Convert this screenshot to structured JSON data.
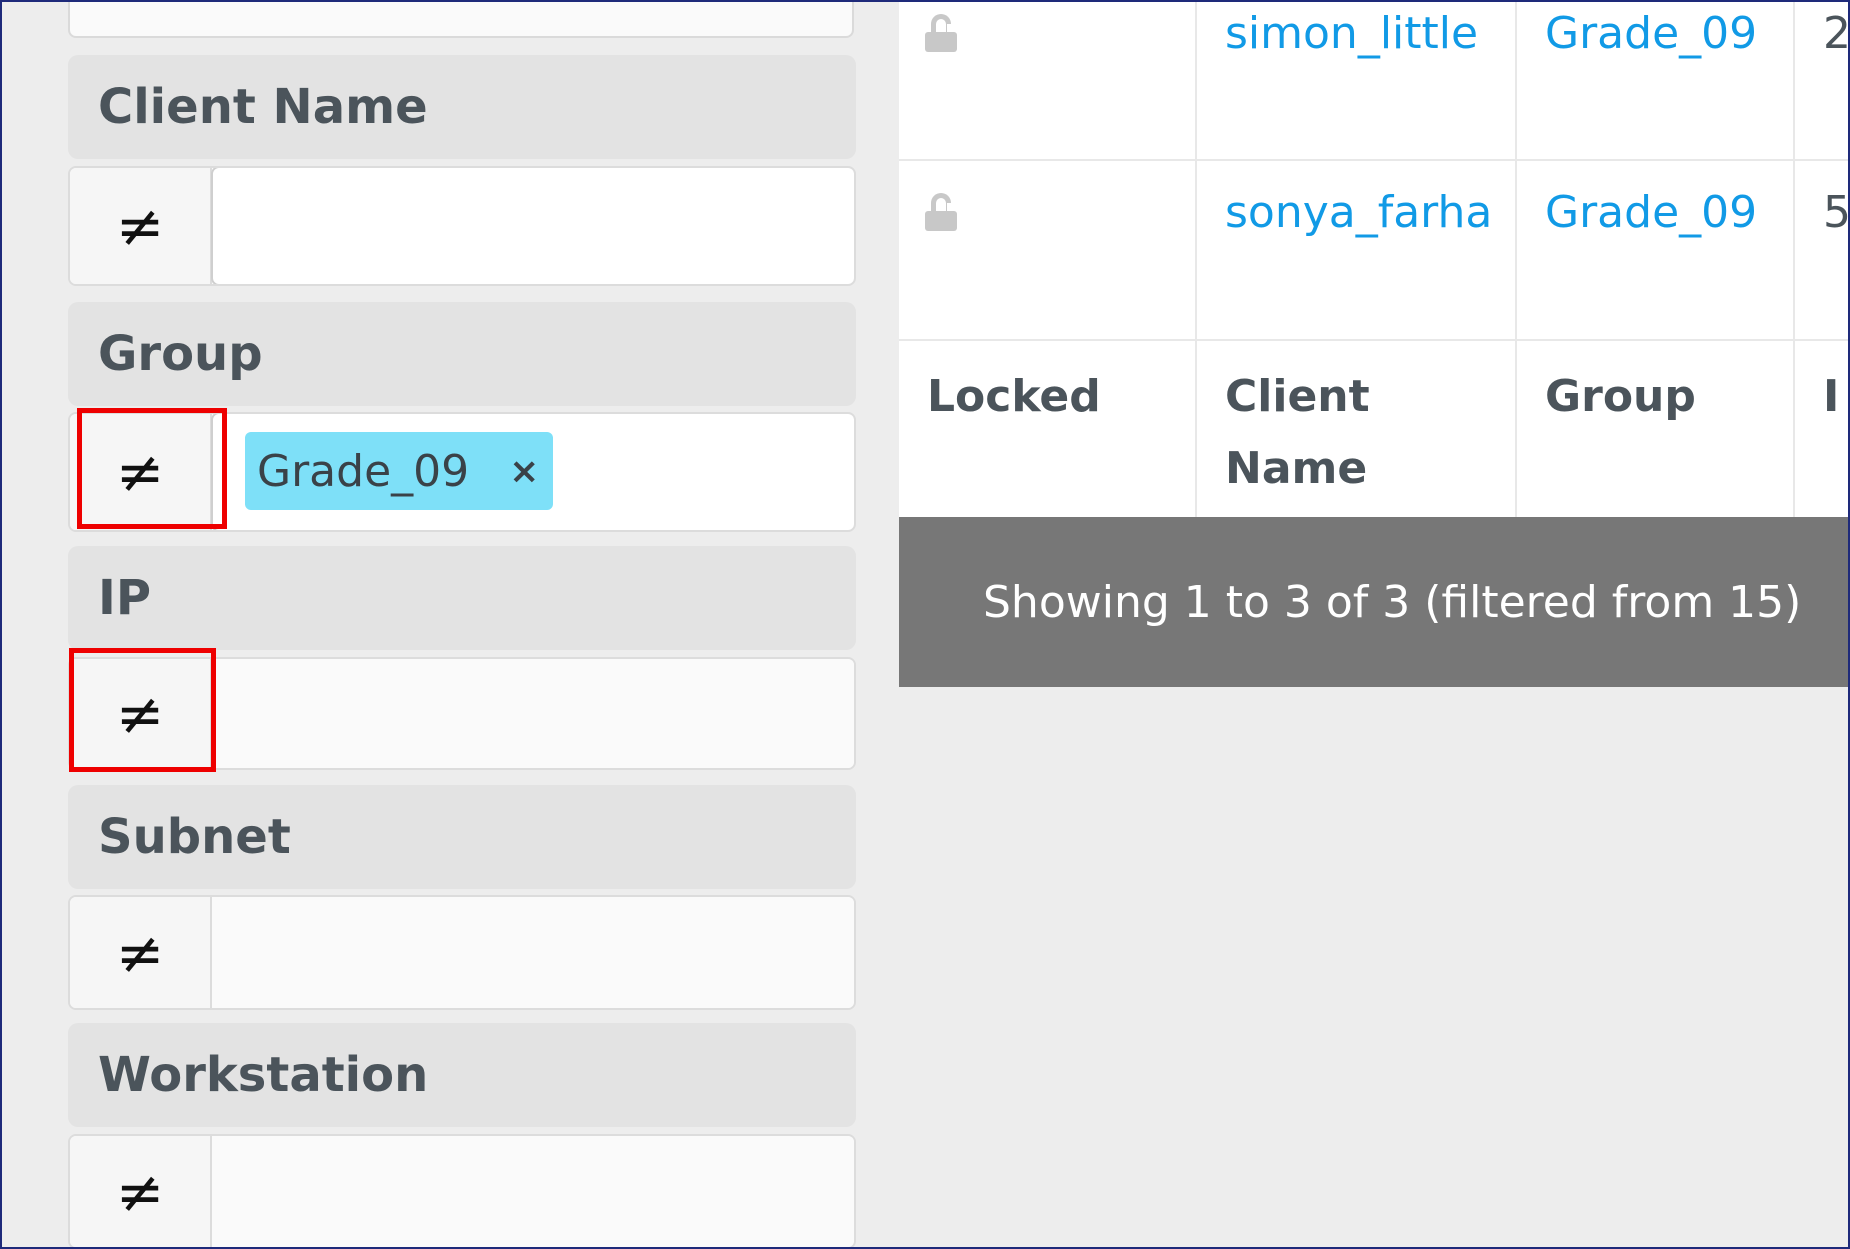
{
  "filters": [
    {
      "header": "Client Name",
      "operator": "≠",
      "value": ""
    },
    {
      "header": "Group",
      "operator": "≠",
      "tags": [
        "Grade_09"
      ]
    },
    {
      "header": "IP",
      "operator": "≠",
      "value": ""
    },
    {
      "header": "Subnet",
      "operator": "≠",
      "value": ""
    },
    {
      "header": "Workstation",
      "operator": "≠",
      "value": ""
    }
  ],
  "tag_remove_symbol": "×",
  "table": {
    "rows": [
      {
        "client_name": "simon_little",
        "group": "Grade_09",
        "ip_partial": "2"
      },
      {
        "client_name": "sonya_farha",
        "group": "Grade_09",
        "ip_partial": "5"
      }
    ],
    "columns": {
      "locked": "Locked",
      "client_name_line1": "Client",
      "client_name_line2": "Name",
      "group": "Group",
      "ip_partial": "I"
    },
    "footer": "Showing 1 to 3 of 3 (filtered from 15)"
  },
  "colors": {
    "link": "#119ae6",
    "tag_bg": "#7ee0f8",
    "highlight": "#ee0000",
    "footer_bg": "#777777"
  }
}
